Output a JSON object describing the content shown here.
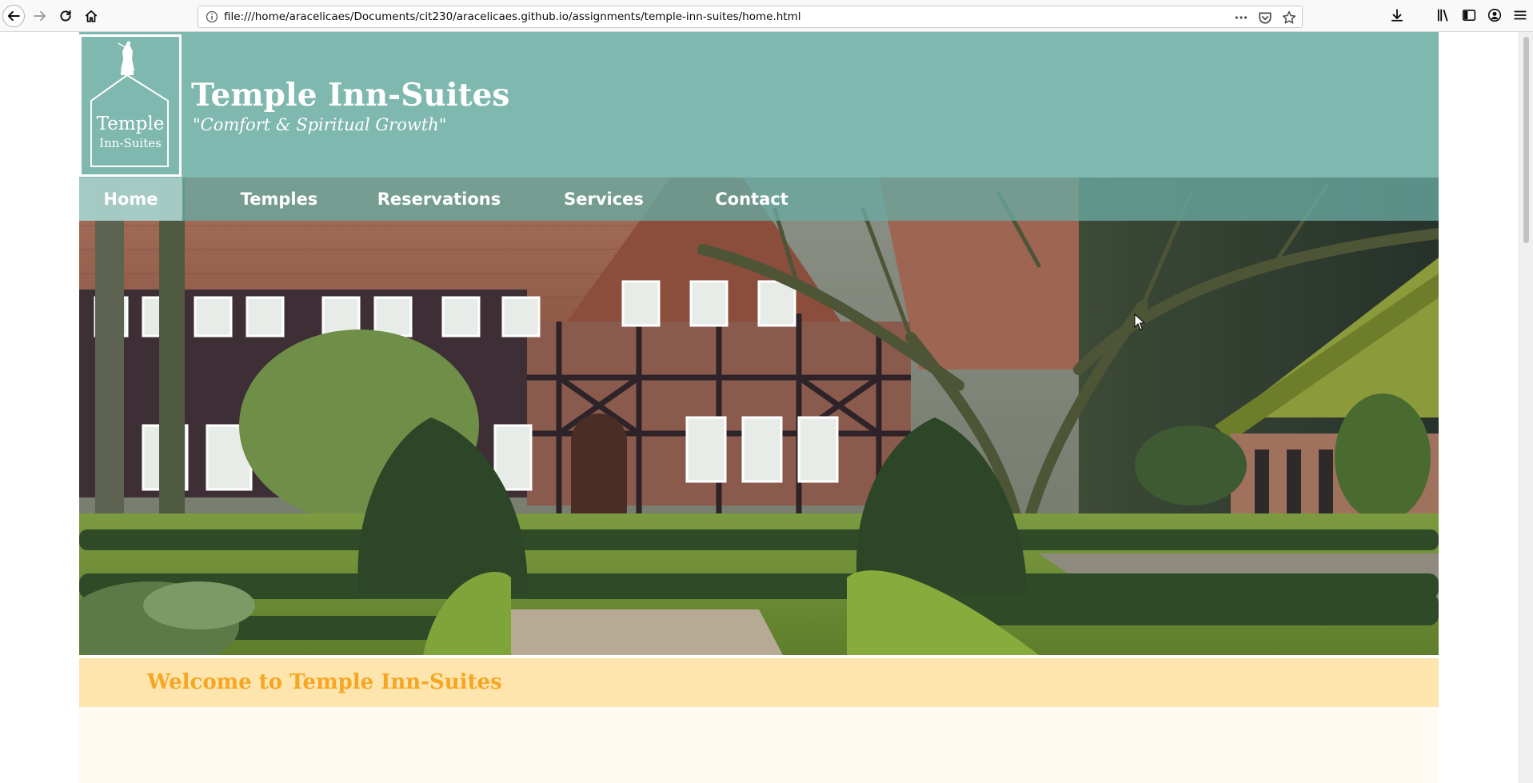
{
  "browser": {
    "url": "file:///home/aracelicaes/Documents/cit230/aracelicaes.github.io/assignments/temple-inn-suites/home.html",
    "icons": {
      "back": "back-arrow-icon",
      "forward": "forward-arrow-icon",
      "reload": "reload-icon",
      "home": "home-icon",
      "info": "info-icon",
      "page_actions": "ellipsis-icon",
      "pocket": "pocket-icon",
      "bookmark": "star-icon",
      "downloads": "download-icon",
      "library": "library-icon",
      "sidebar": "sidebar-icon",
      "account": "account-icon",
      "menu": "hamburger-menu-icon"
    }
  },
  "site": {
    "logo": {
      "line1": "Temple",
      "line2": "Inn-Suites",
      "icon": "temple-angel-logo"
    },
    "title": "Temple Inn-Suites",
    "tagline": "\"Comfort & Spiritual Growth\"",
    "nav": [
      {
        "label": "Home",
        "active": true
      },
      {
        "label": "Temples",
        "active": false
      },
      {
        "label": "Reservations",
        "active": false
      },
      {
        "label": "Services",
        "active": false
      },
      {
        "label": "Contact",
        "active": false
      }
    ],
    "hero": {
      "icon": "half-timbered-manor-garden-photo"
    },
    "welcome": {
      "heading": "Welcome to Temple Inn-Suites"
    }
  },
  "colors": {
    "header_teal": "#7fb8ae",
    "nav_overlay": "#69aaa2",
    "welcome_band": "#fee4ad",
    "welcome_text": "#f5a623",
    "text_white": "#ffffff"
  }
}
